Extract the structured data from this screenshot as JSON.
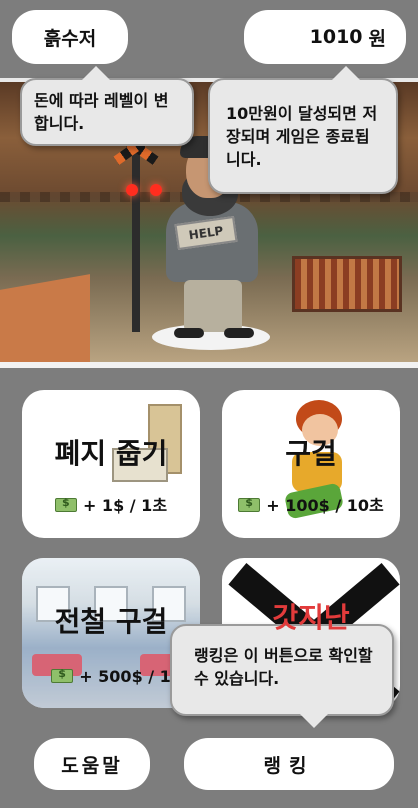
{
  "header": {
    "level_label": "흙수저",
    "money_value": "1010",
    "money_unit": "원"
  },
  "tooltips": {
    "level_hint": "돈에 따라 레벨이 변합니다.",
    "money_hint": "10만원이 달성되면 저장되며 게임은 종료됩니다.",
    "ranking_hint": "랭킹은 이 버튼으로 확인할 수 있습니다."
  },
  "scene": {
    "sign_text": "HELP"
  },
  "jobs": [
    {
      "title": "폐지 줍기",
      "rate": "+ 1$ / 1초"
    },
    {
      "title": "구걸",
      "rate": "+ 100$ / 10초"
    },
    {
      "title": "전철 구걸",
      "rate": "+ 500$ / 1"
    },
    {
      "title": "갓지난"
    }
  ],
  "footer": {
    "help_label": "도움말",
    "ranking_label": "랭킹"
  },
  "icons": {
    "money": "money-bill-icon"
  }
}
